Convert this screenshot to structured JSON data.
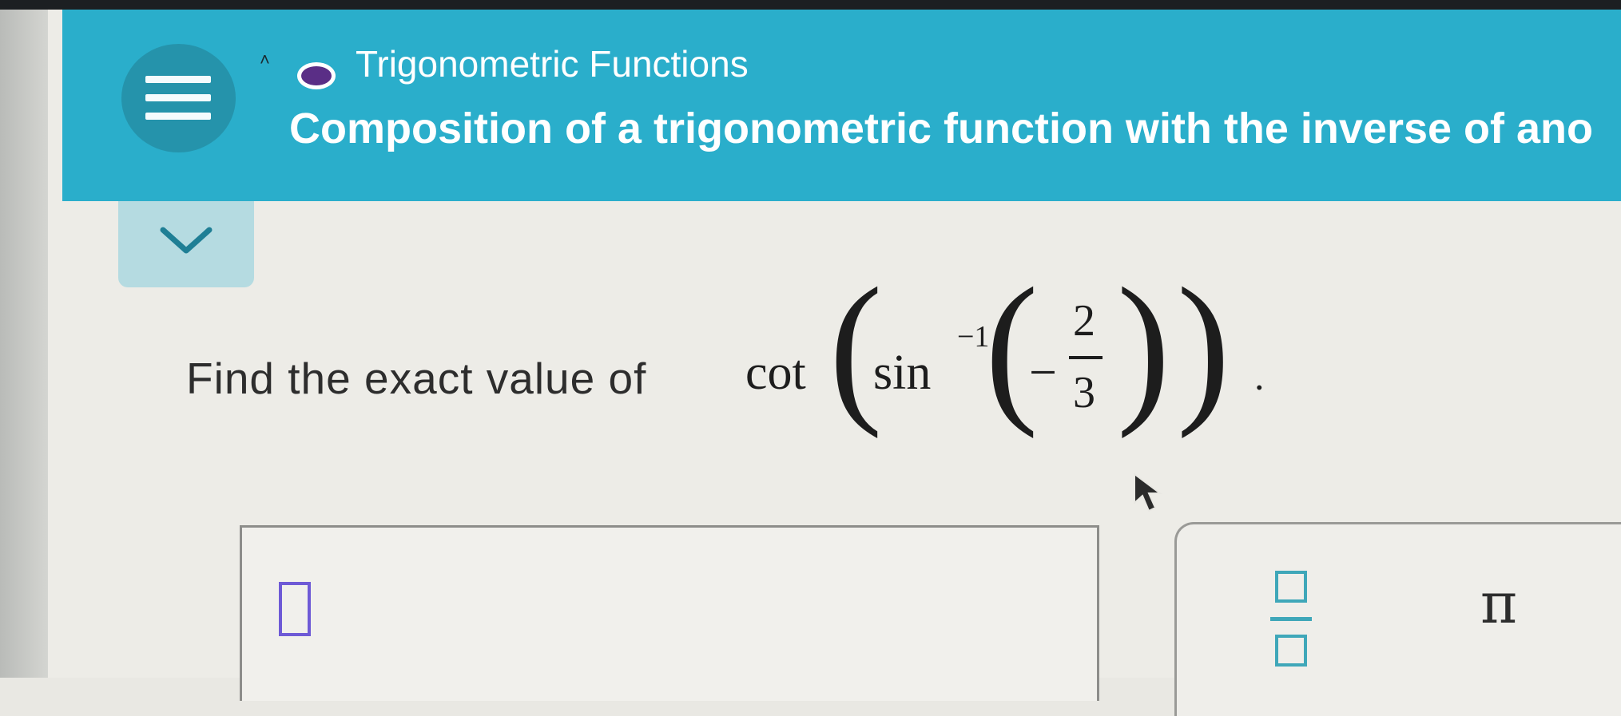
{
  "header": {
    "topic": "Trigonometric Functions",
    "subtitle": "Composition of a trigonometric function with the inverse of ano",
    "caret": "˄"
  },
  "question": {
    "prompt": "Find the exact value of",
    "math": {
      "outer_fn": "cot",
      "inner_fn": "sin",
      "inverse_exponent": "−1",
      "minus": "−",
      "numerator": "2",
      "denominator": "3",
      "left_paren": "(",
      "right_paren": ")",
      "period": "."
    }
  },
  "toolbar": {
    "pi_label": "π"
  },
  "colors": {
    "header_bg": "#2aaecb",
    "menu_button": "#2593ab",
    "topic_dot": "#5a2e86",
    "tool_accent": "#3fa7b9",
    "answer_cursor": "#6e5ad6"
  },
  "icons": [
    "menu-icon",
    "chevron-down-icon",
    "fraction-icon",
    "mouse-pointer-icon"
  ]
}
